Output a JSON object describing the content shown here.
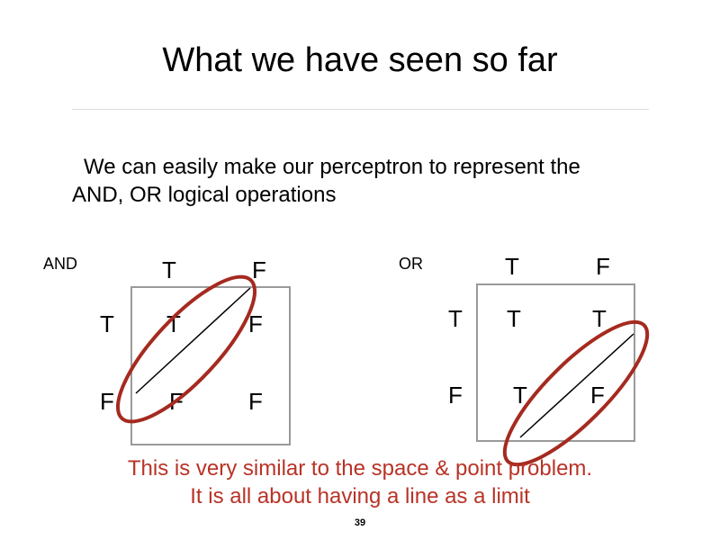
{
  "slide": {
    "title": "What we have seen so far",
    "body": {
      "line1": "We can easily make our perceptron to represent the",
      "line2": "AND, OR logical operations"
    },
    "caption": {
      "line1": "This is very similar to the space & point problem.",
      "line2": "It is all about having a line as a limit"
    },
    "page_number": "39"
  },
  "and_diagram": {
    "label": "AND",
    "col_headers": [
      "T",
      "F"
    ],
    "row_headers": [
      "T",
      "F"
    ],
    "cells": [
      [
        "T",
        "F"
      ],
      [
        "F",
        "F"
      ]
    ]
  },
  "or_diagram": {
    "label": "OR",
    "col_headers": [
      "T",
      "F"
    ],
    "row_headers": [
      "T",
      "F"
    ],
    "cells": [
      [
        "T",
        "T"
      ],
      [
        "T",
        "F"
      ]
    ]
  },
  "colors": {
    "caption": "#b83327",
    "ellipse": "#a52a1f",
    "box": "#9a9a9a",
    "rule": "#dcdcdc"
  }
}
